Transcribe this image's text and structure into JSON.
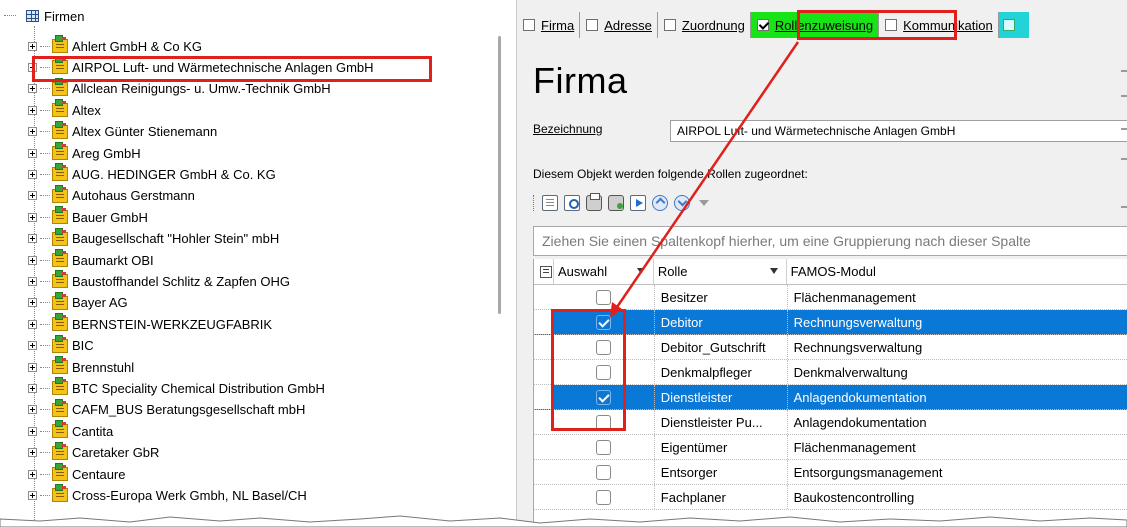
{
  "tree": {
    "root_label": "Firmen",
    "items": [
      {
        "label": "Ahlert GmbH & Co KG"
      },
      {
        "label": "AIRPOL Luft- und Wärmetechnische Anlagen GmbH"
      },
      {
        "label": "Allclean Reinigungs- u. Umw.-Technik GmbH"
      },
      {
        "label": "Altex"
      },
      {
        "label": "Altex  Günter Stienemann"
      },
      {
        "label": "Areg GmbH"
      },
      {
        "label": "AUG. HEDINGER GmbH & Co. KG"
      },
      {
        "label": "Autohaus Gerstmann"
      },
      {
        "label": "Bauer GmbH"
      },
      {
        "label": "Baugesellschaft \"Hohler Stein\" mbH"
      },
      {
        "label": "Baumarkt OBI"
      },
      {
        "label": "Baustoffhandel Schlitz & Zapfen OHG"
      },
      {
        "label": "Bayer AG"
      },
      {
        "label": "BERNSTEIN-WERKZEUGFABRIK"
      },
      {
        "label": "BIC"
      },
      {
        "label": "Brennstuhl"
      },
      {
        "label": "BTC Speciality Chemical Distribution GmbH"
      },
      {
        "label": "CAFM_BUS Beratungsgesellschaft mbH"
      },
      {
        "label": "Cantita"
      },
      {
        "label": "Caretaker GbR"
      },
      {
        "label": "Centaure"
      },
      {
        "label": "Cross-Europa Werk Gmbh, NL Basel/CH"
      }
    ]
  },
  "tabs": [
    {
      "label": "Firma",
      "checked": false
    },
    {
      "label": "Adresse",
      "checked": false
    },
    {
      "label": "Zuordnung",
      "checked": false
    },
    {
      "label": "Rollenzuweisung",
      "checked": true
    },
    {
      "label": "Kommunikation",
      "checked": false
    }
  ],
  "detail": {
    "title": "Firma",
    "bezeichnung_label": "Bezeichnung",
    "bezeichnung_value": "AIRPOL Luft- und Wärmetechnische Anlagen GmbH",
    "roles_caption": "Diesem Objekt werden folgende Rollen zugeordnet:",
    "group_hint": "Ziehen Sie einen Spaltenkopf hierher, um eine Gruppierung nach dieser Spalte",
    "columns": {
      "auswahl": "Auswahl",
      "rolle": "Rolle",
      "modul": "FAMOS-Modul"
    },
    "rows": [
      {
        "rolle": "Besitzer",
        "modul": "Flächenmanagement",
        "checked": false
      },
      {
        "rolle": "Debitor",
        "modul": "Rechnungsverwaltung",
        "checked": true
      },
      {
        "rolle": "Debitor_Gutschrift",
        "modul": "Rechnungsverwaltung",
        "checked": false
      },
      {
        "rolle": "Denkmalpfleger",
        "modul": "Denkmalverwaltung",
        "checked": false
      },
      {
        "rolle": "Dienstleister",
        "modul": "Anlagendokumentation",
        "checked": true
      },
      {
        "rolle": "Dienstleister Pu...",
        "modul": "Anlagendokumentation",
        "checked": false
      },
      {
        "rolle": "Eigentümer",
        "modul": "Flächenmanagement",
        "checked": false
      },
      {
        "rolle": "Entsorger",
        "modul": "Entsorgungsmanagement",
        "checked": false
      },
      {
        "rolle": "Fachplaner",
        "modul": "Baukostencontrolling",
        "checked": false
      }
    ]
  },
  "colors": {
    "active_tab": "#17e317",
    "selection": "#0a78d7",
    "annotation_red": "#e0201c"
  }
}
